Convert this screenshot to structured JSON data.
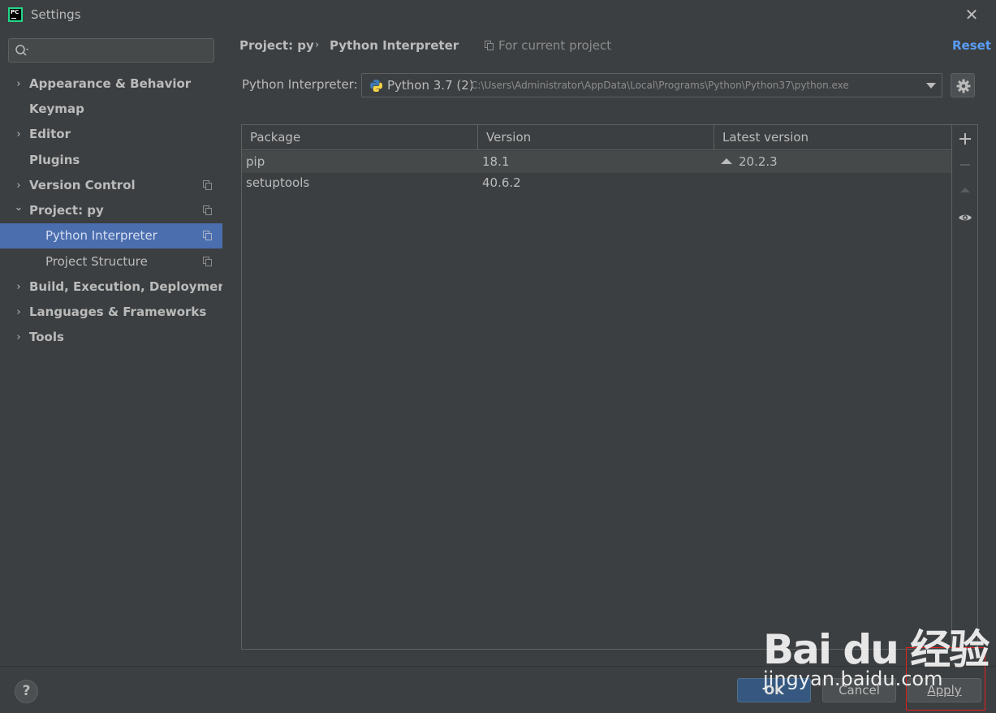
{
  "window": {
    "title": "Settings",
    "app_logo_text": "PC"
  },
  "search": {
    "placeholder": ""
  },
  "sidebar": {
    "items": [
      {
        "label": "Appearance & Behavior",
        "expandable": true,
        "expanded": false
      },
      {
        "label": "Keymap",
        "expandable": false
      },
      {
        "label": "Editor",
        "expandable": true,
        "expanded": false
      },
      {
        "label": "Plugins",
        "expandable": false
      },
      {
        "label": "Version Control",
        "expandable": true,
        "expanded": false,
        "project_scoped": true
      },
      {
        "label": "Project: py",
        "expandable": true,
        "expanded": true,
        "project_scoped": true
      },
      {
        "label": "Python Interpreter",
        "child": true,
        "selected": true,
        "project_scoped": true
      },
      {
        "label": "Project Structure",
        "child": true,
        "project_scoped": true
      },
      {
        "label": "Build, Execution, Deployment",
        "expandable": true,
        "expanded": false
      },
      {
        "label": "Languages & Frameworks",
        "expandable": true,
        "expanded": false
      },
      {
        "label": "Tools",
        "expandable": true,
        "expanded": false
      }
    ],
    "arrow_collapsed": "›",
    "arrow_expanded": "⌄"
  },
  "breadcrumb": {
    "project": "Project: py",
    "separator": "›",
    "page": "Python Interpreter",
    "scope": "For current project",
    "reset": "Reset"
  },
  "interpreter": {
    "label": "Python Interpreter:",
    "name": "Python 3.7 (2)",
    "path": "C:\\Users\\Administrator\\AppData\\Local\\Programs\\Python\\Python37\\python.exe"
  },
  "packages": {
    "columns": [
      "Package",
      "Version",
      "Latest version"
    ],
    "rows": [
      {
        "package": "pip",
        "version": "18.1",
        "latest": "20.2.3",
        "upgrade_available": true
      },
      {
        "package": "setuptools",
        "version": "40.6.2",
        "latest": "",
        "upgrade_available": false
      }
    ]
  },
  "toolbar": {
    "icons": [
      "plus-icon",
      "minus-icon",
      "upgrade-icon",
      "eye-icon"
    ]
  },
  "footer": {
    "help": "?",
    "ok": "OK",
    "cancel": "Cancel",
    "apply": "Apply"
  },
  "watermark": {
    "brand": "Bai du 经验",
    "url": "jingyan.baidu.com"
  },
  "colors": {
    "background": "#3c3f41",
    "selection": "#4b6eaf",
    "accent_link": "#589df6",
    "ok_button": "#365880",
    "highlight": "#e02020"
  }
}
